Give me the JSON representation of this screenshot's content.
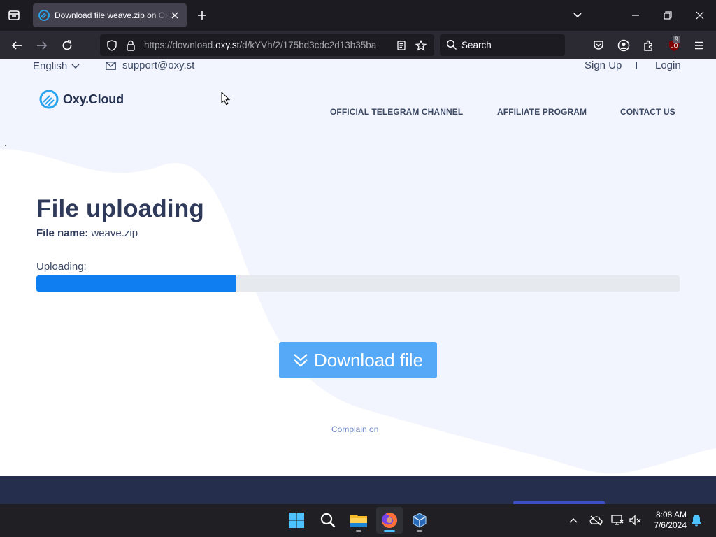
{
  "browser": {
    "tab": {
      "title": "Download file weave.zip on Oxy.Cloud"
    },
    "url": {
      "prefix": "https://download.",
      "domain": "oxy.st",
      "path": "/d/kYVh/2/175bd3cdc2d13b35ba"
    },
    "search": {
      "placeholder": "Search"
    },
    "extensions_badge": "9"
  },
  "page": {
    "topbar": {
      "language": "English",
      "email": "support@oxy.st",
      "signup": "Sign Up",
      "login": "Login"
    },
    "logo": {
      "text": "Oxy.Cloud"
    },
    "menu": [
      {
        "label": "OFFICIAL TELEGRAM CHANNEL"
      },
      {
        "label": "AFFILIATE PROGRAM"
      },
      {
        "label": "CONTACT US"
      }
    ],
    "dots": "...",
    "title": "File uploading",
    "file_name_label": "File name:",
    "file_name": "weave.zip",
    "uploading_label": "Uploading:",
    "progress_percent": 31,
    "download_button": "Download file",
    "complain": "Complain on"
  },
  "taskbar": {
    "apps": [
      "start-icon",
      "search-icon",
      "file-explorer-icon",
      "firefox-icon",
      "virtualbox-icon"
    ],
    "time": "8:08 AM",
    "date": "7/6/2024"
  },
  "colors": {
    "accent": "#0f7ef0",
    "button": "#55a9f7",
    "heading": "#2f3a5a",
    "footer": "#262e4d"
  }
}
